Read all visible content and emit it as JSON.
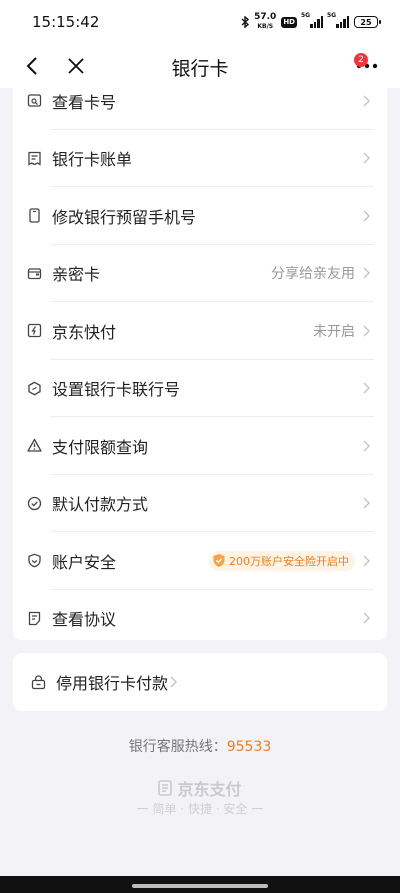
{
  "status_bar": {
    "time": "15:15:42",
    "net_speed_value": "57.0",
    "net_speed_unit": "KB/S",
    "hd_label": "HD",
    "signal_1_label": "5G",
    "signal_2_label": "5G",
    "battery": "25"
  },
  "nav": {
    "title": "银行卡",
    "more_badge": "2"
  },
  "menu": {
    "items": [
      {
        "label": "查看卡号",
        "value": ""
      },
      {
        "label": "银行卡账单",
        "value": ""
      },
      {
        "label": "修改银行预留手机号",
        "value": ""
      },
      {
        "label": "亲密卡",
        "value": "分享给亲友用"
      },
      {
        "label": "京东快付",
        "value": "未开启"
      },
      {
        "label": "设置银行卡联行号",
        "value": ""
      },
      {
        "label": "支付限额查询",
        "value": ""
      },
      {
        "label": "默认付款方式",
        "value": ""
      },
      {
        "label": "账户安全",
        "value": "200万账户安全险开启中"
      },
      {
        "label": "查看协议",
        "value": ""
      }
    ]
  },
  "stop": {
    "label": "停用银行卡付款"
  },
  "footer": {
    "hotline_label": "银行客服热线：",
    "hotline_number": "95533",
    "brand": "京东支付",
    "slogan": "一 简单 · 快捷 · 安全 一"
  },
  "colors": {
    "accent": "#f07d1e",
    "badge": "#f2333a",
    "background": "#f2f2f7"
  }
}
